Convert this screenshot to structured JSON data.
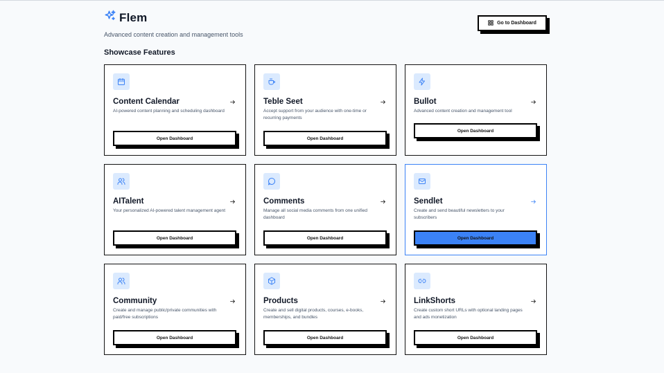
{
  "app": {
    "name": "Flem",
    "tagline": "Advanced content creation and management tools"
  },
  "header": {
    "dashboard_button": "Go to Dashboard"
  },
  "section_title": "Showcase Features",
  "colors": {
    "accent": "#3b82f6",
    "icon_bg": "#dbeafe",
    "icon": "#3b82f6"
  },
  "cards": [
    {
      "title": "Content Calendar",
      "description": "AI-powered content planning and scheduling dashboard",
      "button": "Open Dashboard",
      "icon": "calendar-icon"
    },
    {
      "title": "Teble Seet",
      "description": "Accept support from your audience with one-time or recurring payments",
      "button": "Open Dashboard",
      "icon": "coffee-cup-icon"
    },
    {
      "title": "Bullot",
      "description": "Advanced content creation and management tool",
      "button": "Open Dashboard",
      "icon": "lightning-icon"
    },
    {
      "title": "AITalent",
      "description": "Your personalized AI-powered talent management agent",
      "button": "Open Dashboard",
      "icon": "users-icon"
    },
    {
      "title": "Comments",
      "description": "Manage all social media comments from one unified dashboard",
      "button": "Open Dashboard",
      "icon": "message-circle-icon"
    },
    {
      "title": "Sendlet",
      "description": "Create and send beautiful newsletters to your subscribers",
      "button": "Open Dashboard",
      "icon": "mail-icon"
    },
    {
      "title": "Community",
      "description": "Create and manage public/private communities with paid/free subscriptions",
      "button": "Open Dashboard",
      "icon": "community-users-icon"
    },
    {
      "title": "Products",
      "description": "Create and sell digital products, courses, e-books, memberships, and bundles",
      "button": "Open Dashboard",
      "icon": "package-icon"
    },
    {
      "title": "LinkShorts",
      "description": "Create custom short URLs with optional landing pages and ads monetization",
      "button": "Open Dashboard",
      "icon": "link-icon"
    }
  ]
}
